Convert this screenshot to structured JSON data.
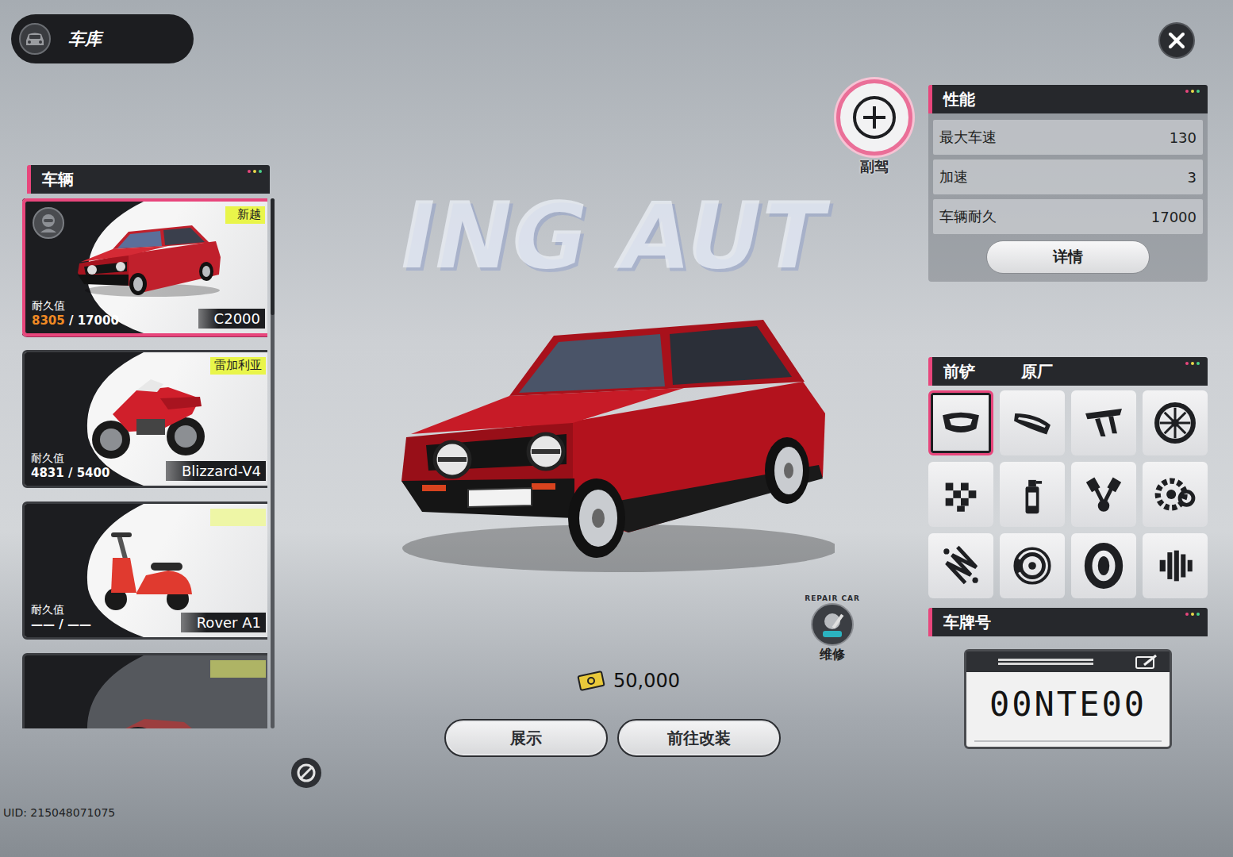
{
  "header": {
    "title": "车库"
  },
  "copilot": {
    "label": "副驾"
  },
  "backdrop_text": "ING AUT",
  "vehicles": {
    "title": "车辆",
    "scrollbar": {
      "level": 0.22
    },
    "items": [
      {
        "name": "C2000",
        "tag": "新越",
        "durability_label": "耐久值",
        "current": "8305",
        "rest": "/ 17000",
        "warn": true,
        "selected": true,
        "driving": true,
        "locked": false,
        "kind": "car"
      },
      {
        "name": "Blizzard-V4",
        "tag": "雷加利亚",
        "durability_label": "耐久值",
        "current": "4831",
        "rest": "/ 5400",
        "warn": false,
        "selected": false,
        "driving": false,
        "locked": false,
        "kind": "motorbike"
      },
      {
        "name": "Rover A1",
        "tag": "",
        "durability_label": "耐久值",
        "current": "——",
        "rest": "/ ——",
        "warn": false,
        "selected": false,
        "driving": false,
        "locked": false,
        "kind": "scooter"
      },
      {
        "name": "",
        "tag": "",
        "durability_label": "",
        "current": "",
        "rest": "",
        "warn": false,
        "selected": false,
        "driving": false,
        "locked": true,
        "kind": "locked"
      }
    ]
  },
  "performance": {
    "title": "性能",
    "stats": [
      {
        "label": "最大车速",
        "value": "130"
      },
      {
        "label": "加速",
        "value": "3"
      },
      {
        "label": "车辆耐久",
        "value": "17000"
      }
    ],
    "details_button": "详情"
  },
  "parts": {
    "category": "前铲",
    "value": "原厂",
    "items": [
      {
        "kind": "front-bumper",
        "selected": true
      },
      {
        "kind": "rear-bumper",
        "selected": false
      },
      {
        "kind": "spoiler",
        "selected": false
      },
      {
        "kind": "rim",
        "selected": false
      },
      {
        "kind": "decal",
        "selected": false
      },
      {
        "kind": "paint",
        "selected": false
      },
      {
        "kind": "engine",
        "selected": false
      },
      {
        "kind": "gearbox",
        "selected": false
      },
      {
        "kind": "suspension",
        "selected": false
      },
      {
        "kind": "brake",
        "selected": false
      },
      {
        "kind": "tire",
        "selected": false
      },
      {
        "kind": "transmission",
        "selected": false
      }
    ]
  },
  "plate": {
    "title": "车牌号",
    "number": "00NTE00"
  },
  "repair": {
    "label": "维修",
    "badge": "REPAIR CAR"
  },
  "currency": {
    "amount": "50,000"
  },
  "actions": [
    {
      "label": "展示"
    },
    {
      "label": "前往改装"
    }
  ],
  "uid": "UID: 215048071075"
}
